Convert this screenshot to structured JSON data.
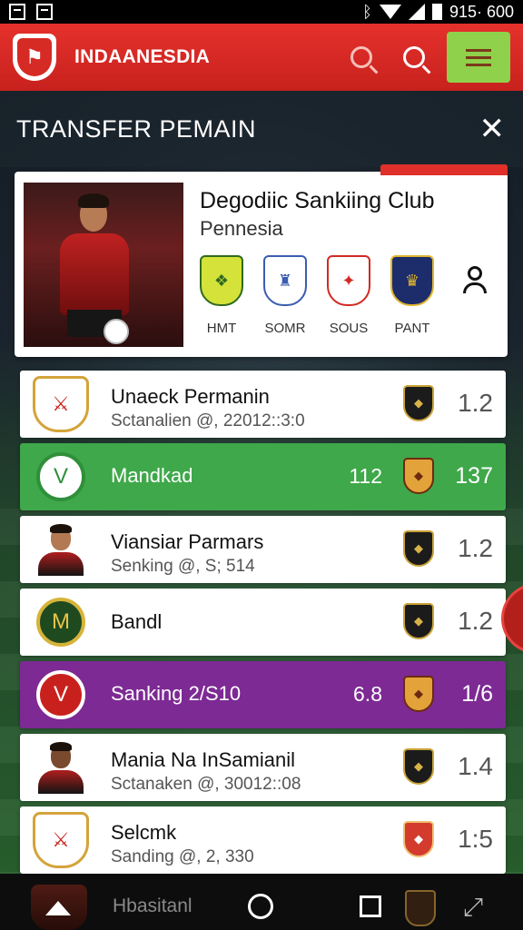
{
  "status_bar": {
    "time": "915· 600"
  },
  "header": {
    "title": "INDAANESDIA",
    "logo_glyph": "⚑"
  },
  "panel": {
    "title": "TRANSFER PEMAIN",
    "close_glyph": "✕"
  },
  "club": {
    "name": "Degodiic Sankiing Club",
    "subtitle": "Pennesia",
    "crests": [
      {
        "label": "HMT",
        "color": "#d4e23a",
        "glyph": "❖"
      },
      {
        "label": "SOMR",
        "color": "#3a5db0",
        "glyph": "♜"
      },
      {
        "label": "SOUS",
        "color": "#d12a22",
        "glyph": "✦"
      },
      {
        "label": "PANT",
        "color": "#e0b530",
        "glyph": "♛"
      }
    ]
  },
  "rows": [
    {
      "title": "Unaeck Permanin",
      "subtitle": "Sctanalien @, 22012::3:0",
      "value": "1.2"
    },
    {
      "title": "Mandkad",
      "mid": "112",
      "value": "137"
    },
    {
      "title": "Viansiar Parmars",
      "subtitle": "Senking @, S; 514",
      "value": "1.2"
    },
    {
      "title": "Bandl",
      "value": "1.2"
    },
    {
      "title": "Sanking 2/S10",
      "mid": "6.8",
      "value": "1/6"
    },
    {
      "title": "Mania Na InSamianil",
      "subtitle": "Sctanaken @, 30012::08",
      "value": "1.4"
    },
    {
      "title": "Selcmk",
      "subtitle": "Sanding @, 2, 330",
      "value": "1:5"
    }
  ],
  "bottom_nav": {
    "label": "Hbasitanl"
  },
  "colors": {
    "header_red": "#d62a24",
    "row_green": "#3fa84a",
    "row_purple": "#7d2a94",
    "menu_green": "#8fd14a"
  }
}
